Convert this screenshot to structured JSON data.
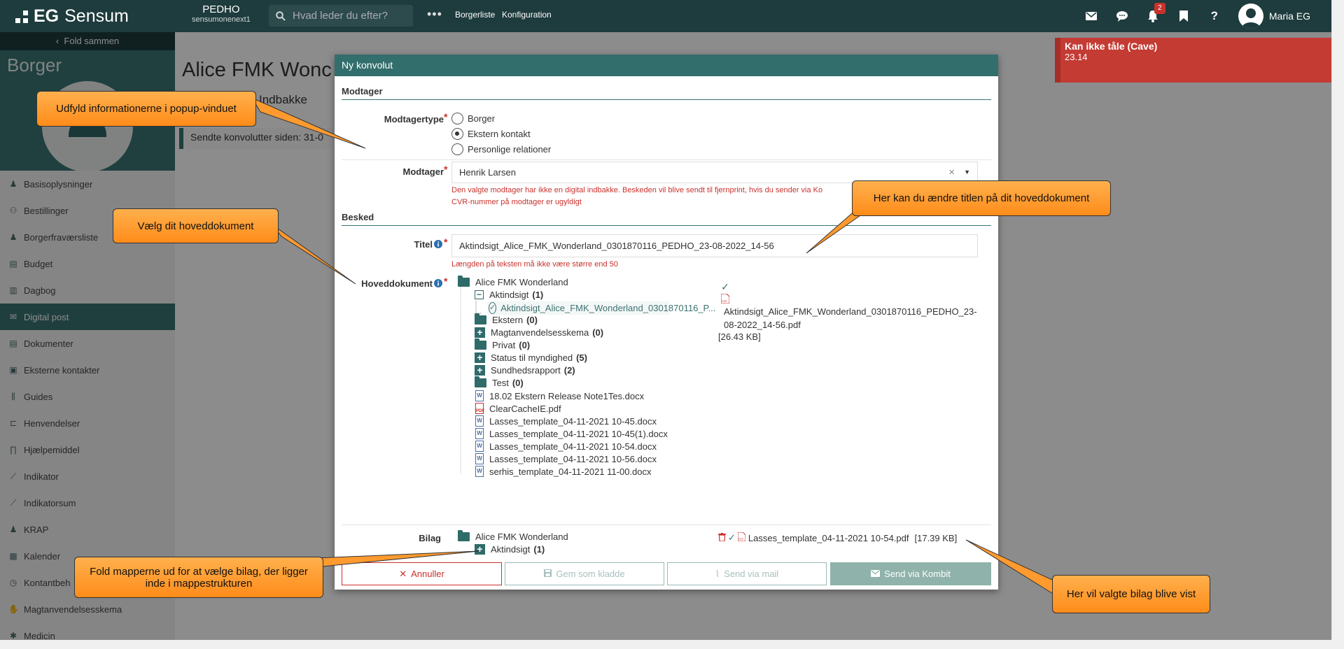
{
  "topbar": {
    "brand": "Sensum",
    "brand_prefix": "EG",
    "org_code": "PEDHO",
    "org_sub": "sensumonenext1",
    "search_placeholder": "Hvad leder du efter?",
    "links": [
      "Borgerliste",
      "Konfiguration"
    ],
    "notification_count": "2",
    "user_name": "Maria EG"
  },
  "sidebar": {
    "fold_label": "Fold sammen",
    "section_label": "Borger",
    "items": [
      {
        "label": "Basisoplysninger",
        "icon": "person-icon"
      },
      {
        "label": "Bestillinger",
        "icon": "people-icon"
      },
      {
        "label": "Borgerfraværsliste",
        "icon": "person-icon"
      },
      {
        "label": "Budget",
        "icon": "document-icon"
      },
      {
        "label": "Dagbog",
        "icon": "book-icon"
      },
      {
        "label": "Digital post",
        "icon": "envelope-icon",
        "active": true
      },
      {
        "label": "Dokumenter",
        "icon": "document-icon"
      },
      {
        "label": "Eksterne kontakter",
        "icon": "contact-icon"
      },
      {
        "label": "Guides",
        "icon": "books-icon"
      },
      {
        "label": "Henvendelser",
        "icon": "inquiry-icon"
      },
      {
        "label": "Hjælpemiddel",
        "icon": "tool-icon"
      },
      {
        "label": "Indikator",
        "icon": "chart-icon"
      },
      {
        "label": "Indikatorsum",
        "icon": "chart-icon"
      },
      {
        "label": "KRAP",
        "icon": "person-icon"
      },
      {
        "label": "Kalender",
        "icon": "calendar-icon"
      },
      {
        "label": "Kontantbeh",
        "icon": "money-icon"
      },
      {
        "label": "Magtanvendelsesskema",
        "icon": "hand-icon"
      },
      {
        "label": "Medicin",
        "icon": "pill-icon"
      }
    ]
  },
  "page": {
    "title": "Alice FMK Wonc",
    "tab": "Indbakke",
    "sendte_label": "Sendte konvolutter siden:",
    "sendte_value": "31-0"
  },
  "alert": {
    "title": "Kan ikke tåle (Cave)",
    "detail": "23.14"
  },
  "modal": {
    "title": "Ny konvolut",
    "section_recipient": "Modtager",
    "recipient_type_label": "Modtagertype",
    "recipient_types": [
      {
        "label": "Borger",
        "selected": false
      },
      {
        "label": "Ekstern kontakt",
        "selected": true
      },
      {
        "label": "Personlige relationer",
        "selected": false
      }
    ],
    "recipient_label": "Modtager",
    "recipient_value": "Henrik Larsen",
    "recipient_error_1": "Den valgte modtager har ikke en digital indbakke. Beskeden vil blive sendt til fjernprint, hvis du sender via Ko",
    "recipient_error_2": "CVR-nummer på modtager er ugyldigt",
    "section_message": "Besked",
    "title_label": "Titel",
    "title_value": "Aktindsigt_Alice_FMK_Wonderland_0301870116_PEDHO_23-08-2022_14-56",
    "title_error": "Længden på teksten må ikke være større end 50",
    "main_doc_label": "Hoveddokument",
    "tree": {
      "root": "Alice FMK Wonderland",
      "aktindsigt": {
        "label": "Aktindsigt",
        "count": "(1)"
      },
      "selected_file": "Aktindsigt_Alice_FMK_Wonderland_0301870116_P...",
      "folders": [
        {
          "label": "Ekstern",
          "count": "(0)",
          "type": "folder"
        },
        {
          "label": "Magtanvendelsesskema",
          "count": "(0)",
          "type": "plus"
        },
        {
          "label": "Privat",
          "count": "(0)",
          "type": "folder"
        },
        {
          "label": "Status til myndighed",
          "count": "(5)",
          "type": "plus"
        },
        {
          "label": "Sundhedsrapport",
          "count": "(2)",
          "type": "plus"
        },
        {
          "label": "Test",
          "count": "(0)",
          "type": "folder"
        }
      ],
      "files": [
        {
          "label": "18.02 Ekstern Release Note1Tes.docx",
          "type": "word"
        },
        {
          "label": "ClearCacheIE.pdf",
          "type": "pdf"
        },
        {
          "label": "Lasses_template_04-11-2021 10-45.docx",
          "type": "word"
        },
        {
          "label": "Lasses_template_04-11-2021 10-45(1).docx",
          "type": "word"
        },
        {
          "label": "Lasses_template_04-11-2021 10-54.docx",
          "type": "word"
        },
        {
          "label": "Lasses_template_04-11-2021 10-56.docx",
          "type": "word"
        },
        {
          "label": "serhis_template_04-11-2021 11-00.docx",
          "type": "word"
        }
      ]
    },
    "preview": {
      "filename": "Aktindsigt_Alice_FMK_Wonderland_0301870116_PEDHO_23-08-2022_14-56.pdf",
      "size": "[26.43 KB]"
    },
    "attachment_label": "Bilag",
    "attachment_tree_root": "Alice FMK Wonderland",
    "attachment_tree_child": {
      "label": "Aktindsigt",
      "count": "(1)"
    },
    "attachment_file": "Lasses_template_04-11-2021 10-54.pdf",
    "attachment_size": "[17.39 KB]",
    "buttons": {
      "cancel": "Annuller",
      "draft": "Gem som kladde",
      "mail": "Send via mail",
      "kombit": "Send via Kombit"
    }
  },
  "callouts": {
    "fill_popup": "Udfyld informationerne i popup-vinduet",
    "choose_main": "Vælg dit hoveddokument",
    "change_title": "Her kan du ændre titlen på dit hoveddokument",
    "expand_folders": "Fold mapperne ud for at vælge bilag, der ligger inde i mappestrukturen",
    "attachments_shown": "Her vil valgte bilag blive vist"
  },
  "colors": {
    "topbar": "#1e3b3d",
    "accent": "#3a7371",
    "error": "#c8322d",
    "callout": "#ff9a2e"
  }
}
